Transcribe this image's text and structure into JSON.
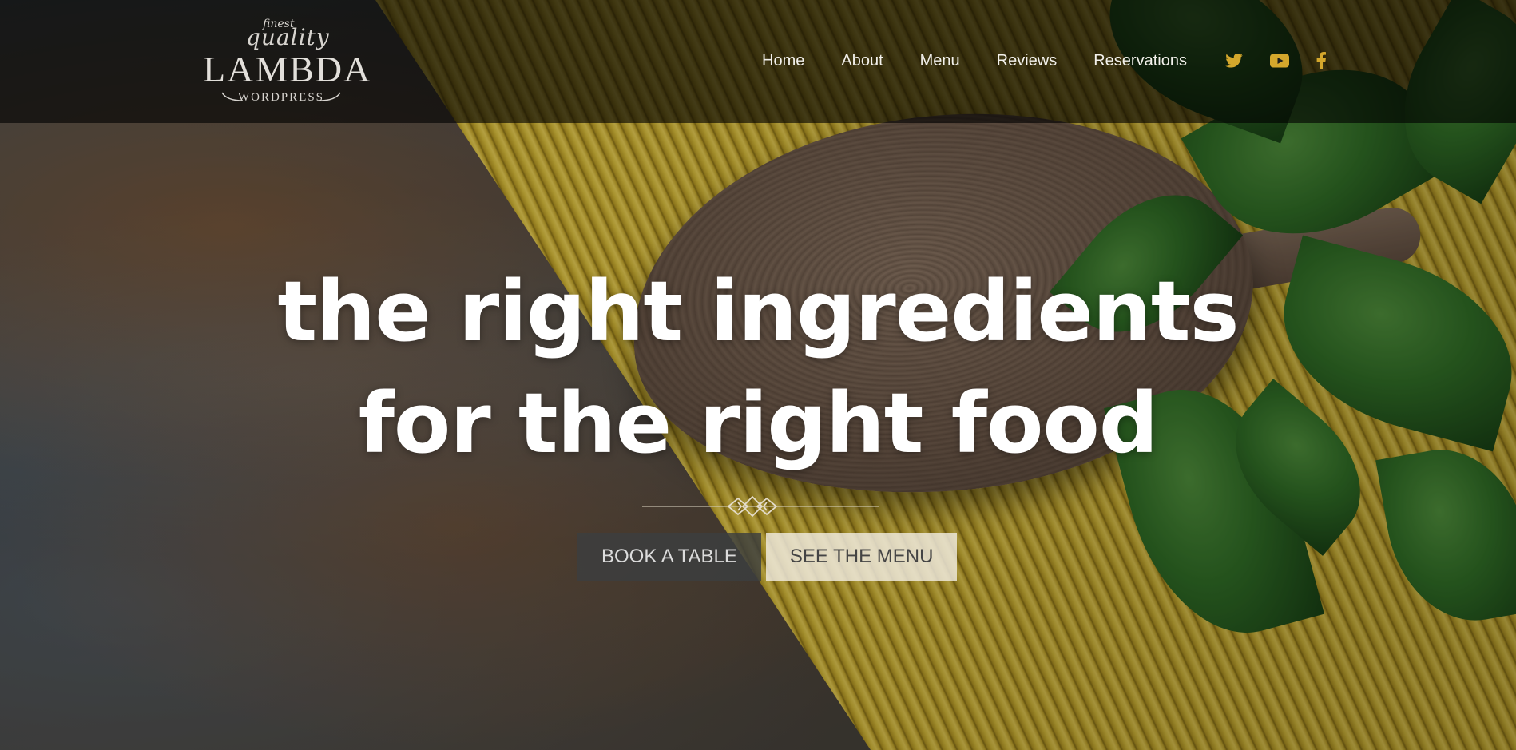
{
  "logo": {
    "finest": "finest",
    "quality": "quality",
    "name": "LAMBDA",
    "sub": "WORDPRESS"
  },
  "nav": {
    "items": [
      {
        "label": "Home"
      },
      {
        "label": "About"
      },
      {
        "label": "Menu"
      },
      {
        "label": "Reviews"
      },
      {
        "label": "Reservations"
      }
    ],
    "social": [
      {
        "icon": "twitter-icon"
      },
      {
        "icon": "youtube-icon"
      },
      {
        "icon": "facebook-icon"
      }
    ],
    "social_color": "#d4a72c"
  },
  "hero": {
    "headline_line1": "the right ingredients",
    "headline_line2": "for the right food",
    "book_button": "BOOK A TABLE",
    "menu_button": "SEE THE MENU"
  }
}
